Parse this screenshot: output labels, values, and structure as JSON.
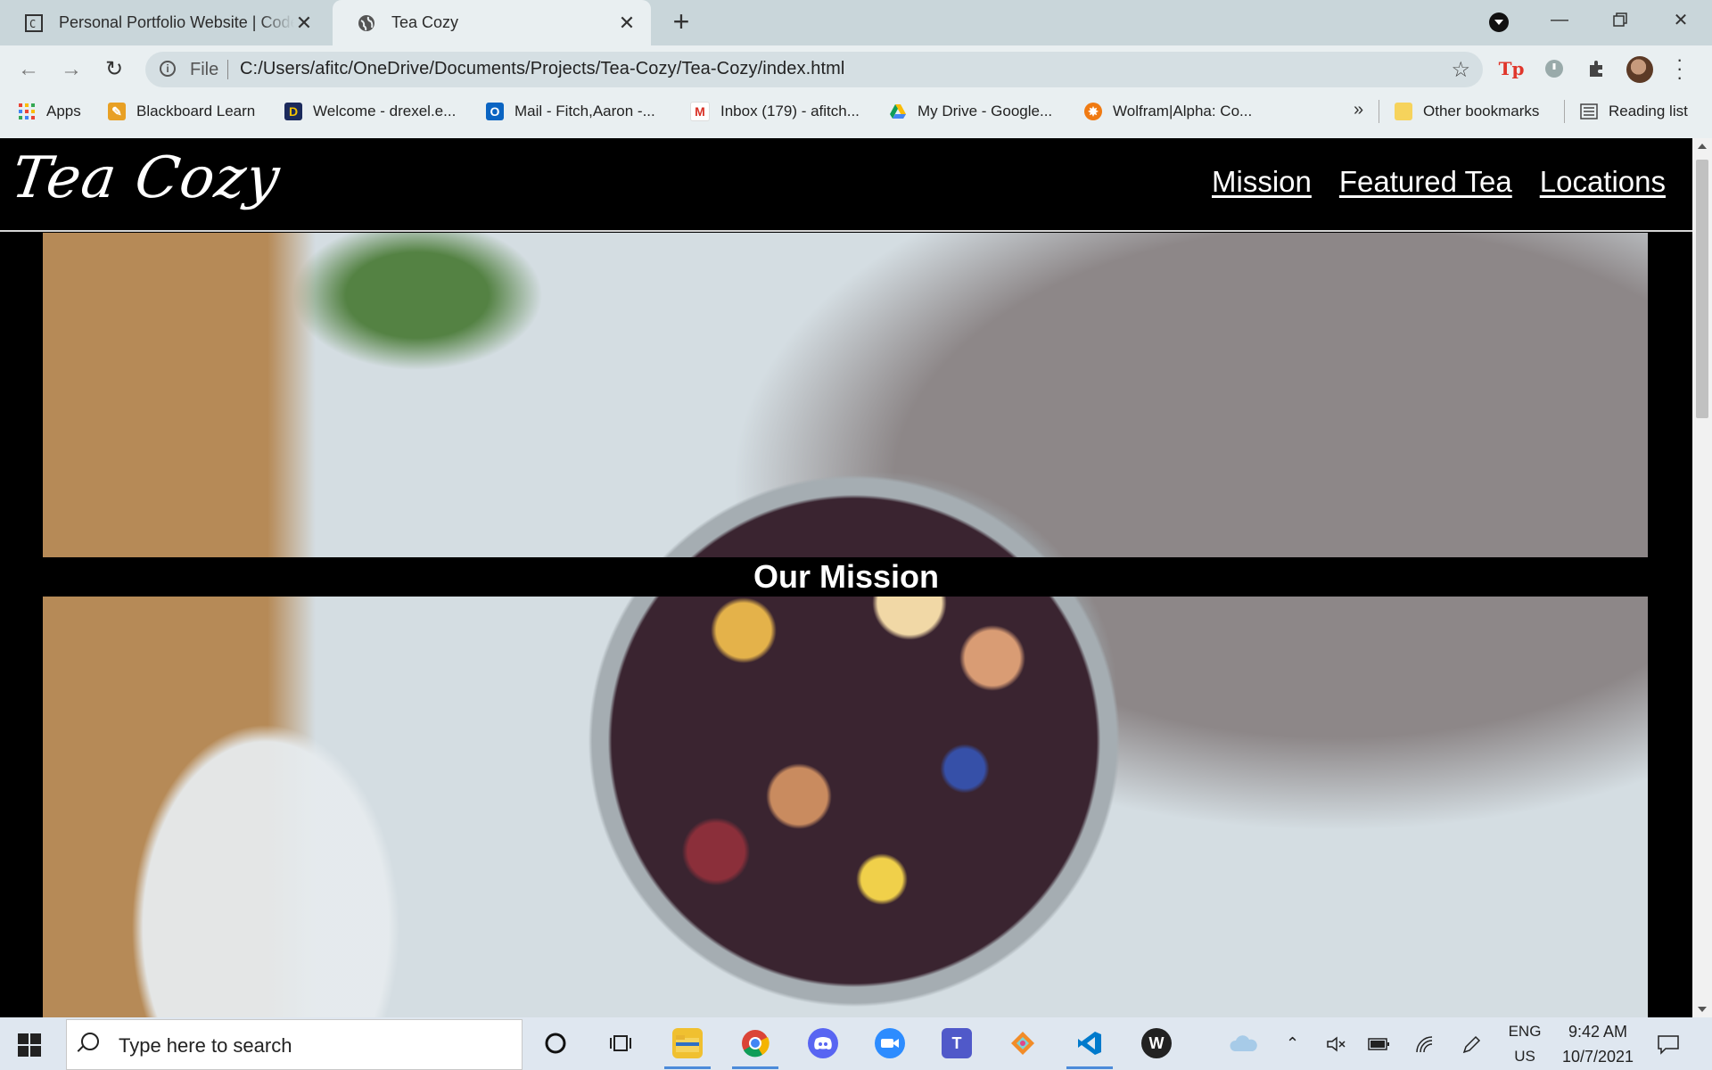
{
  "browser": {
    "tabs": [
      {
        "title": "Personal Portfolio Website | Code",
        "active": false
      },
      {
        "title": "Tea Cozy",
        "active": true
      }
    ],
    "address": {
      "scheme_label": "File",
      "url": "C:/Users/afitc/OneDrive/Documents/Projects/Tea-Cozy/Tea-Cozy/index.html"
    },
    "bookmarks": [
      {
        "label": "Apps",
        "icon": "apps-grid-icon"
      },
      {
        "label": "Blackboard Learn",
        "icon": "blackboard-icon"
      },
      {
        "label": "Welcome - drexel.e...",
        "icon": "drexel-dragon-icon"
      },
      {
        "label": "Mail - Fitch,Aaron -...",
        "icon": "outlook-icon"
      },
      {
        "label": "Inbox (179) - afitch...",
        "icon": "gmail-icon"
      },
      {
        "label": "My Drive - Google...",
        "icon": "google-drive-icon"
      },
      {
        "label": "Wolfram|Alpha: Co...",
        "icon": "wolfram-icon"
      }
    ],
    "bookmarks_more": "»",
    "other_bookmarks": "Other bookmarks",
    "reading_list": "Reading list"
  },
  "site": {
    "logo": "Tea Cozy",
    "nav": [
      "Mission",
      "Featured Tea",
      "Locations"
    ],
    "mission_title": "Our Mission"
  },
  "taskbar": {
    "search_placeholder": "Type here to search",
    "lang_line1": "ENG",
    "lang_line2": "US",
    "time": "9:42 AM",
    "date": "10/7/2021"
  },
  "colors": {
    "page_bg": "#000000",
    "nav_text": "#ffffff",
    "chrome_tabbar": "#c9d6da",
    "chrome_toolbar": "#e9eff1"
  }
}
